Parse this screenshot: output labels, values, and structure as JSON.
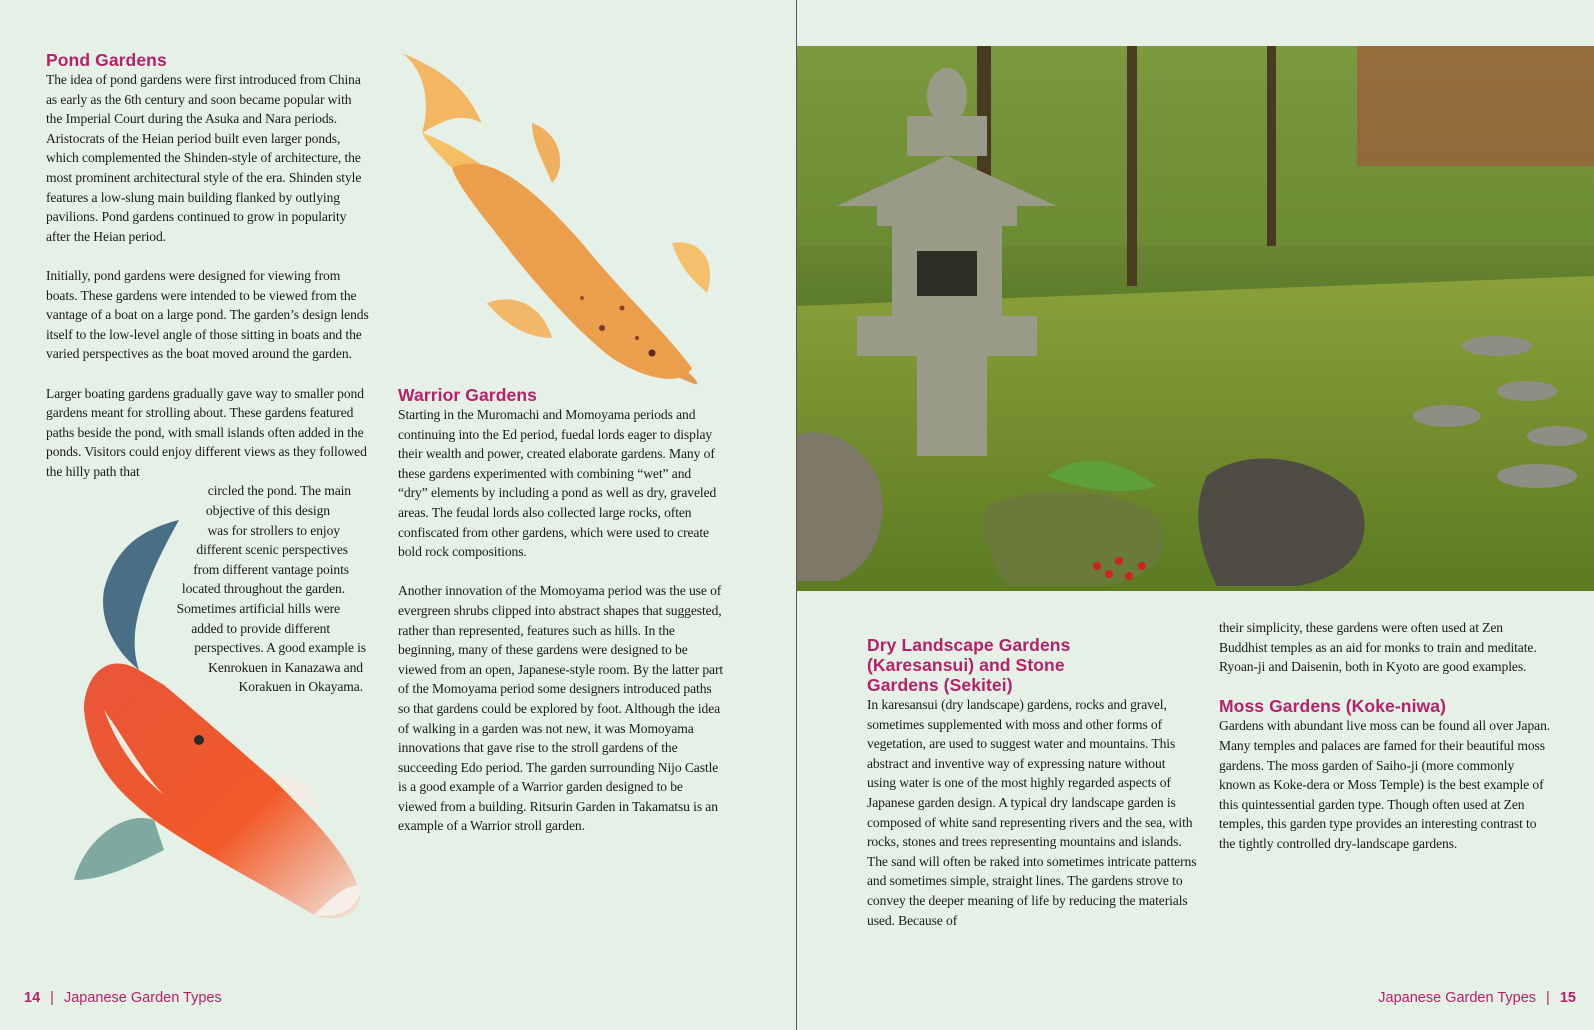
{
  "left_page": {
    "pond": {
      "heading": "Pond Gardens",
      "para1": "The idea of pond gardens were first introduced from China as early as the 6th century and soon became popular with the Imperial Court during the Asuka and Nara periods. Aristocrats of the Heian period built even larger ponds, which complemented the Shinden-style of architecture, the most prominent architectural style of the era. Shinden style features a low-slung main building flanked by outlying pavilions. Pond gardens continued to grow in popularity after the Heian period.",
      "para2": "Initially, pond gardens were designed for viewing from boats. These gardens were intended to be viewed from the vantage of a boat on a large pond. The garden’s design lends itself to the low-level angle of those sitting in boats and the varied perspectives as the boat moved around the garden.",
      "para3_intro": "Larger boating gardens gradually gave way to smaller pond gardens meant for strolling about. These gardens featured paths beside the pond, with small islands often added in the ponds. Visitors could enjoy different views as they followed the hilly path that",
      "para3_wrap": [
        "circled the pond. The main",
        "objective of this design",
        "was for strollers to enjoy",
        "different scenic perspectives",
        "from different vantage points",
        "located throughout the garden.",
        "Sometimes artificial hills were",
        "added to provide different",
        "perspectives. A good example is",
        "Kenrokuen in Kanazawa and",
        "Korakuen in Okayama."
      ]
    },
    "warrior": {
      "heading": "Warrior Gardens",
      "para1": "Starting in the Muromachi and Momoyama periods and continuing into the Ed period, fuedal lords eager to display their wealth and power, created elaborate gardens. Many of these gardens experimented with combining “wet” and “dry” elements by including a pond as well as dry, graveled areas. The feudal lords also collected large rocks, often confiscated from other gardens, which were used to create bold rock compositions.",
      "para2": "Another innovation of the Momoyama period was the use of evergreen shrubs clipped into abstract shapes that suggested, rather than represented, features such as hills. In the beginning, many of these gardens were designed to be viewed from an open, Japanese-style room. By the latter part of the Momoyama period some designers introduced paths so that gardens could be explored by foot. Although the idea of walking in a garden was not new, it was Momoyama innovations that gave rise to the stroll gardens of the succeeding Edo period. The garden surrounding Nijo Castle is a good example of a Warrior garden designed to be viewed from a building. Ritsurin Garden in Takamatsu is an example of a Warrior stroll garden."
    },
    "footer": {
      "page": "14",
      "sep": "|",
      "title": "Japanese Garden Types"
    }
  },
  "right_page": {
    "dry": {
      "heading": "Dry Landscape Gardens (Karesansui) and Stone Gardens (Sekitei)",
      "para1": "In karesansui (dry landscape) gardens, rocks and gravel, sometimes supplemented with moss and other forms of vegetation, are used to suggest water and mountains. This abstract and inventive way of expressing nature without using water is one of the most highly regarded aspects of Japanese garden design. A typical dry landscape garden is composed of white sand representing rivers and the sea, with rocks, stones and trees representing mountains and islands. The sand will often be raked into sometimes intricate patterns and sometimes simple, straight lines. The gardens strove to convey the deeper meaning of life by reducing the materials used. Because of",
      "para1_cont": "their simplicity, these gardens were often used at Zen Buddhist temples as an aid for monks to train and meditate. Ryoan-ji and Daisenin, both in Kyoto are good examples."
    },
    "moss": {
      "heading": "Moss Gardens (Koke-niwa)",
      "para1": "Gardens with abundant live moss can be found all over Japan. Many temples and palaces are famed for their beautiful moss gardens. The moss garden of Saiho-ji (more commonly known as Koke-dera or Moss Temple) is the best example of this quintessential garden type. Though often used at Zen temples, this garden type provides an interesting contrast to the tightly controlled dry-landscape gardens."
    },
    "footer": {
      "title": "Japanese Garden Types",
      "sep": "|",
      "page": "15"
    }
  },
  "colors": {
    "accent": "#b8206a",
    "background": "#e5f1e6"
  }
}
